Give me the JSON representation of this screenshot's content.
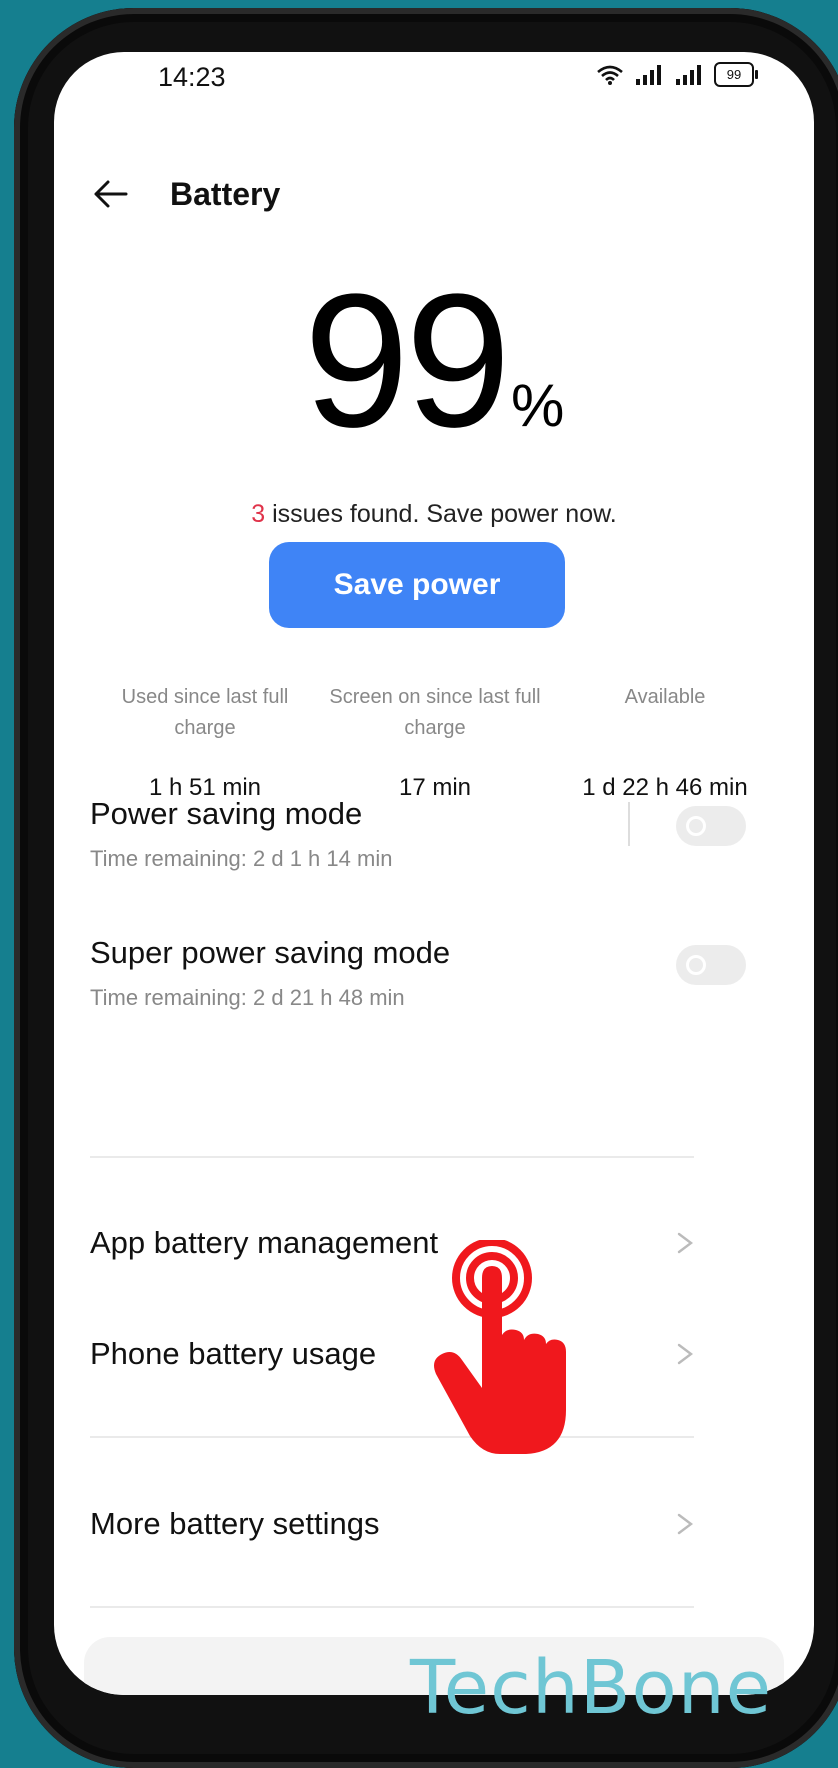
{
  "status_bar": {
    "time": "14:23",
    "battery_level": "99"
  },
  "header": {
    "title": "Battery"
  },
  "battery": {
    "percent": "99",
    "percent_symbol": "%"
  },
  "issues": {
    "count": "3",
    "text": " issues found. Save power now."
  },
  "save_button": {
    "label": "Save power"
  },
  "stats": [
    {
      "label": "Used since last full charge",
      "value": "1 h 51 min"
    },
    {
      "label": "Screen on since last full charge",
      "value": "17 min"
    },
    {
      "label": "Available",
      "value": "1 d 22 h 46 min"
    }
  ],
  "modes": [
    {
      "title": "Power saving mode",
      "subtitle": "Time remaining:  2 d 1 h 14 min",
      "enabled": false
    },
    {
      "title": "Super power saving mode",
      "subtitle": "Time remaining:  2 d 21 h 48 min",
      "enabled": false
    }
  ],
  "menu": [
    {
      "label": "App battery management"
    },
    {
      "label": "Phone battery usage"
    },
    {
      "label": "More battery settings"
    }
  ],
  "watermark": "TechBone",
  "colors": {
    "accent": "#3f84f6",
    "issue_count": "#e0334a",
    "background": "#157f8f",
    "hand": "#f0181d"
  }
}
